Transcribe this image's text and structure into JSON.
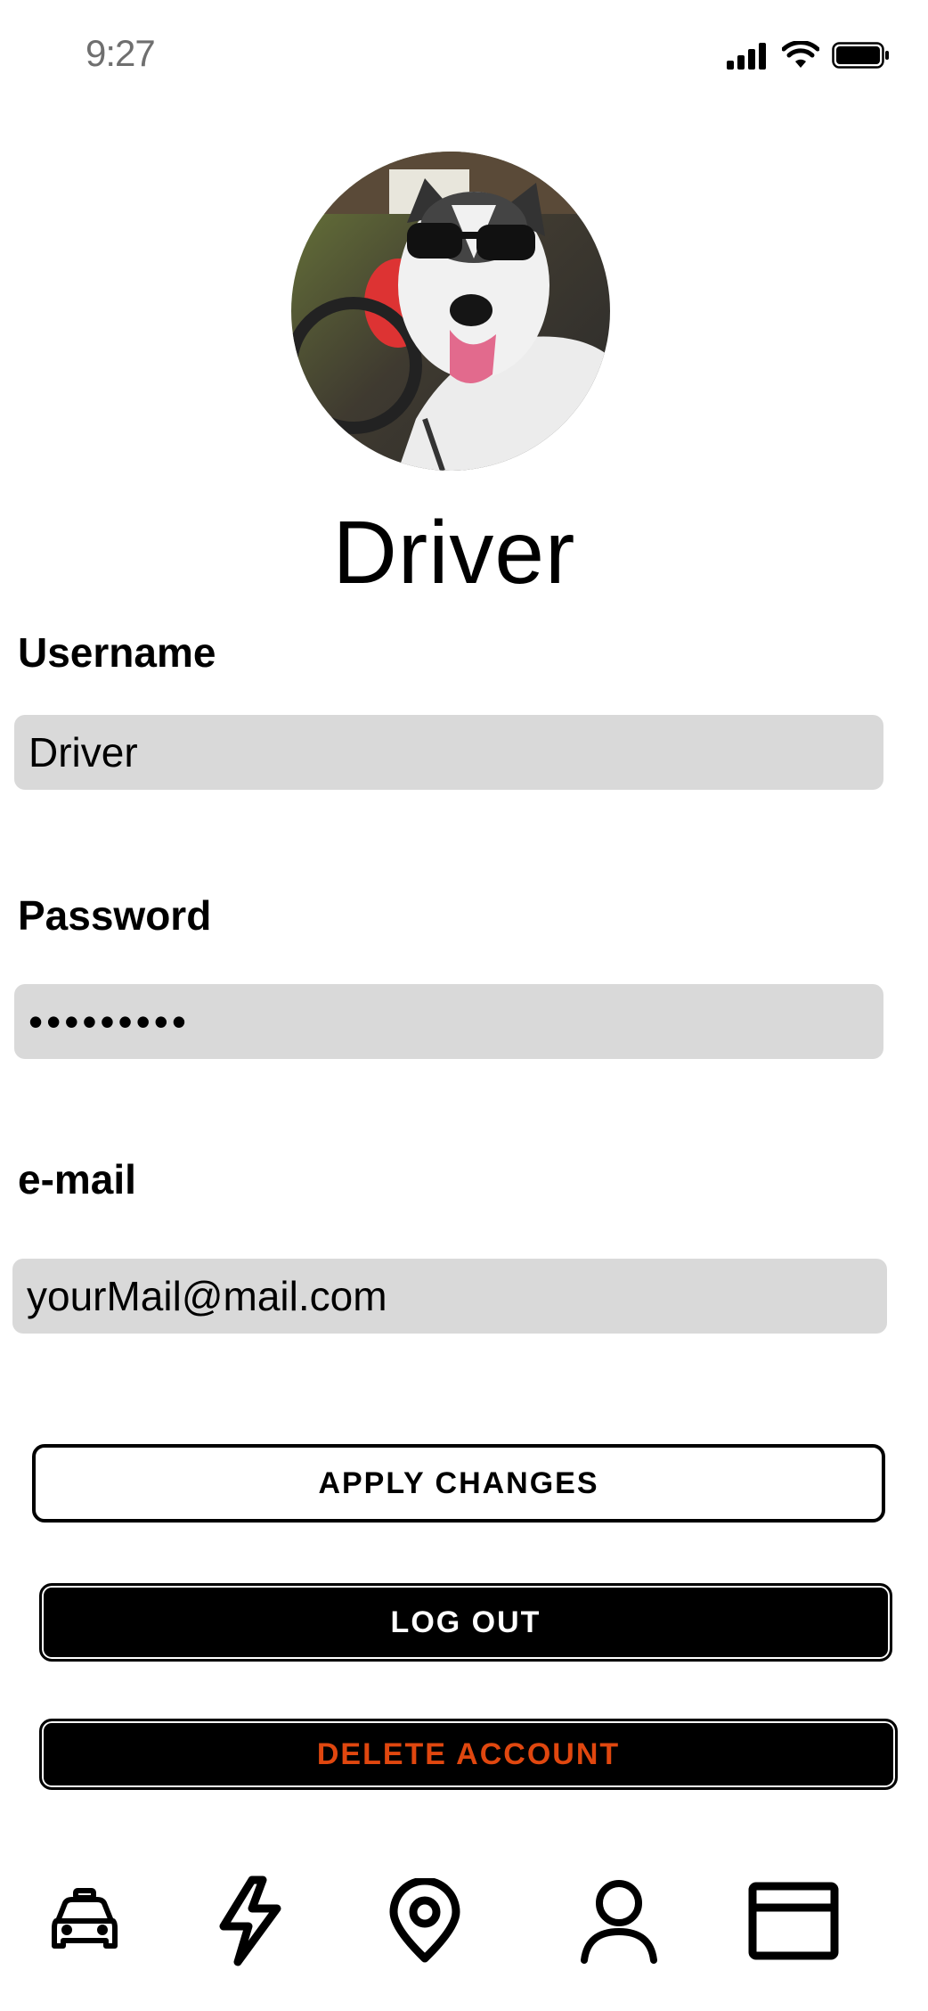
{
  "status_bar": {
    "time": "9:27"
  },
  "profile": {
    "title": "Driver"
  },
  "form": {
    "username_label": "Username",
    "username_value": "Driver",
    "password_label": "Password",
    "password_value": "•••••••••",
    "email_label": "e-mail",
    "email_value": "yourMail@mail.com"
  },
  "buttons": {
    "apply": "APPLY CHANGES",
    "logout": "LOG OUT",
    "delete": "DELETE ACCOUNT"
  },
  "colors": {
    "input_bg": "#d9d9d9",
    "delete_text": "#e0470f"
  },
  "nav": {
    "items": [
      {
        "icon": "car-icon"
      },
      {
        "icon": "lightning-icon"
      },
      {
        "icon": "location-pin-icon"
      },
      {
        "icon": "user-icon"
      },
      {
        "icon": "card-icon"
      }
    ]
  }
}
